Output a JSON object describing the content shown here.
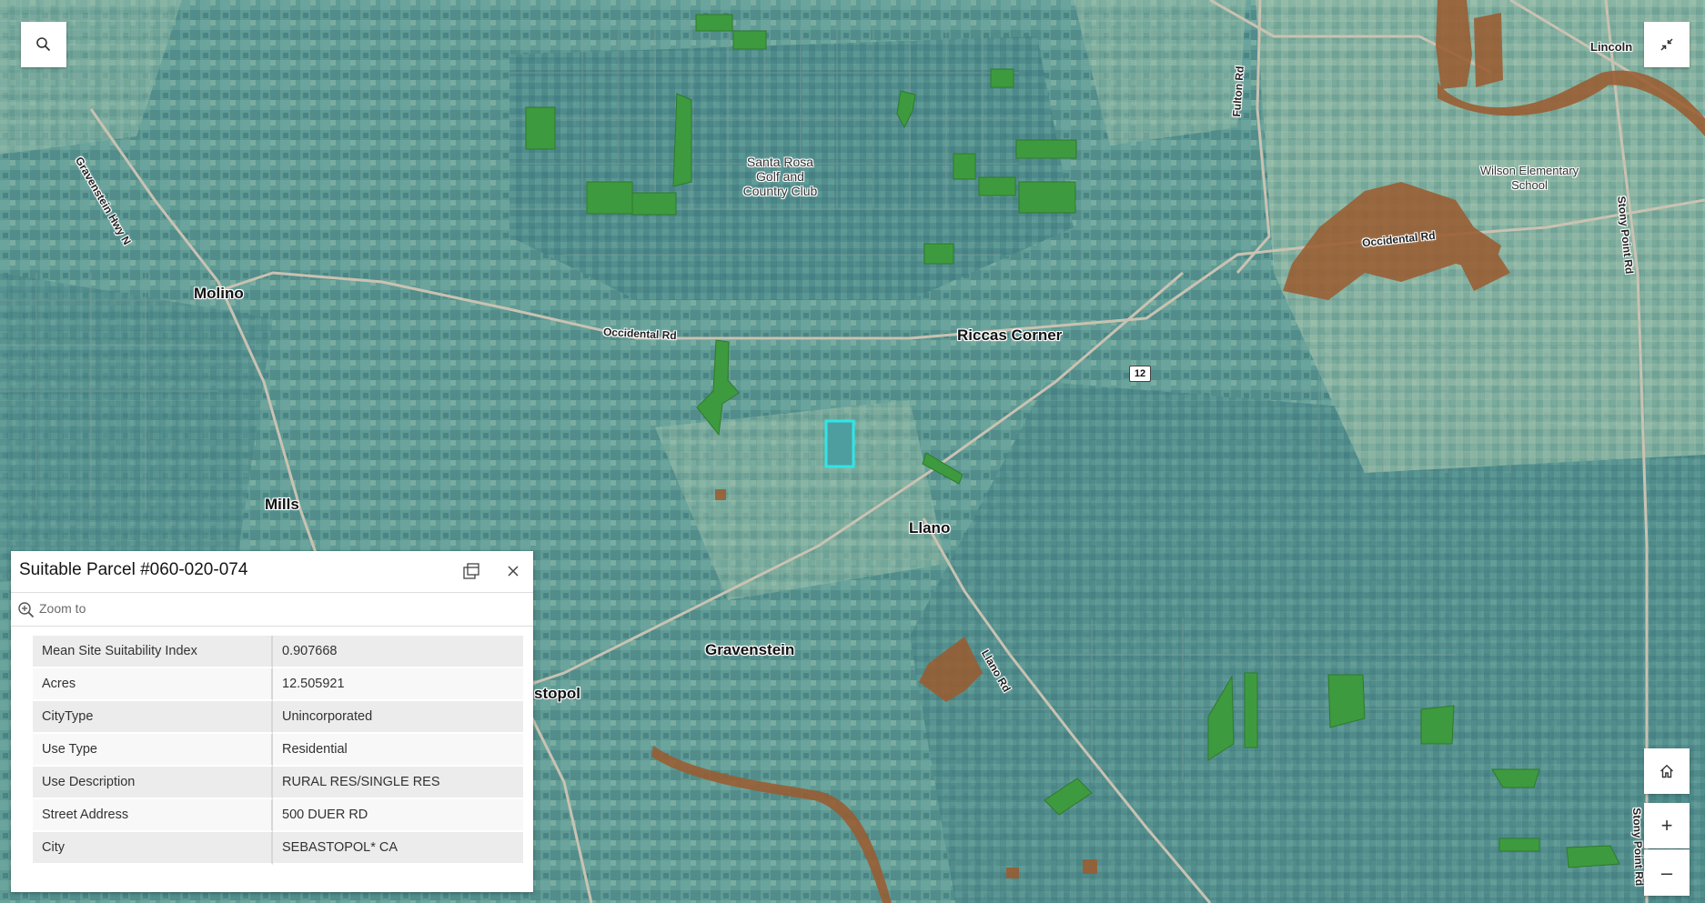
{
  "map": {
    "places": {
      "molino": "Molino",
      "mills": "Mills",
      "riccas_corner": "Riccas Corner",
      "llano": "Llano",
      "gravenstein": "Gravenstein",
      "sebastopol_partial": "stopol",
      "lincoln_partial": "Lincoln"
    },
    "roads": {
      "gravenstein_hwy": "Gravenstein Hwy N",
      "occidental_west": "Occidental Rd",
      "occidental_east": "Occidental Rd",
      "fulton": "Fulton Rd",
      "stony_point_top": "Stony Point Rd",
      "stony_point_bottom": "Stony Point Rd",
      "llano_rd": "Llano Rd",
      "route_shield": "12"
    },
    "pois": {
      "golf_line1": "Santa Rosa",
      "golf_line2": "Golf and",
      "golf_line3": "Country Club",
      "school_line1": "Wilson Elementary",
      "school_line2": "School"
    },
    "colors": {
      "suitable_parcel": "#3e9a3e",
      "unsuitable_area": "#9b5a2e",
      "selected_outline": "#2fe6e6",
      "base_teal": "#5f9a94"
    },
    "controls": {
      "search_icon": "search-icon",
      "collapse_icon": "collapse-icon",
      "home_icon": "home-icon",
      "zoom_in": "+",
      "zoom_out": "–"
    }
  },
  "popup": {
    "title": "Suitable Parcel #060-020-074",
    "zoom_to": "Zoom to",
    "dock_icon": "dock-icon",
    "close_icon": "close-icon",
    "fields": [
      {
        "key": "Mean Site Suitability Index",
        "value": "0.907668"
      },
      {
        "key": "Acres",
        "value": "12.505921"
      },
      {
        "key": "CityType",
        "value": "Unincorporated"
      },
      {
        "key": "Use Type",
        "value": "Residential"
      },
      {
        "key": "Use Description",
        "value": "RURAL RES/SINGLE RES"
      },
      {
        "key": "Street Address",
        "value": "500 DUER RD"
      },
      {
        "key": "City",
        "value": "SEBASTOPOL* CA"
      }
    ]
  }
}
